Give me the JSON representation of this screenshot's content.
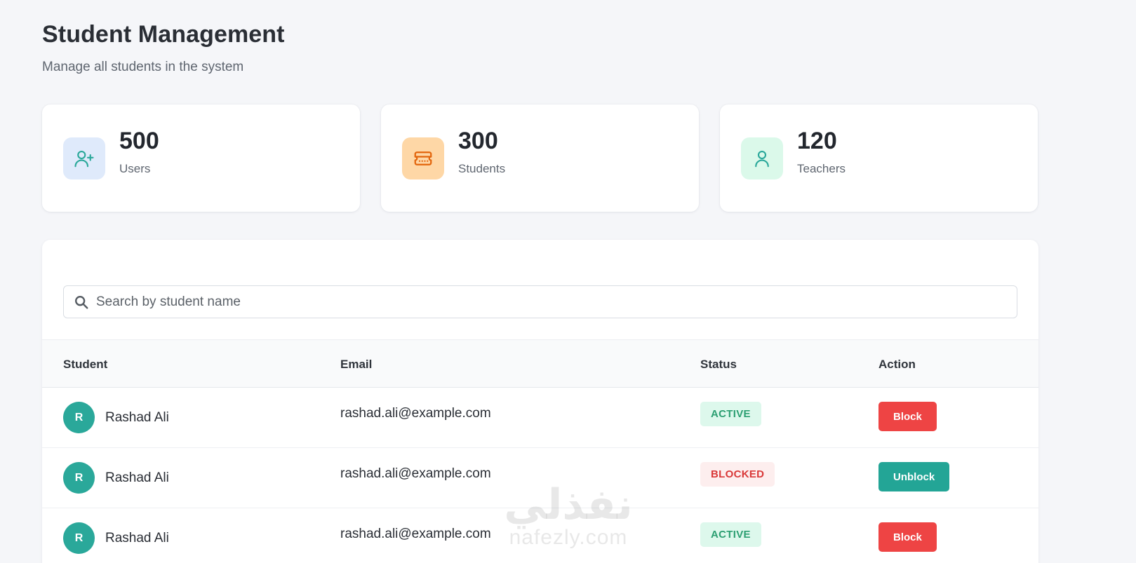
{
  "header": {
    "title": "Student Management",
    "subtitle": "Manage all students in the system"
  },
  "stats": [
    {
      "value": "500",
      "label": "Users",
      "icon": "user-plus-icon",
      "bg": "#dfeafb",
      "color": "#2aa89a"
    },
    {
      "value": "300",
      "label": "Students",
      "icon": "ticket-icon",
      "bg": "#fed7a6",
      "color": "#e2650c"
    },
    {
      "value": "120",
      "label": "Teachers",
      "icon": "user-icon",
      "bg": "#dbf9ea",
      "color": "#2aa89a"
    }
  ],
  "search": {
    "placeholder": "Search by student name",
    "value": ""
  },
  "table": {
    "columns": [
      "Student",
      "Email",
      "Status",
      "Action"
    ],
    "rows": [
      {
        "initial": "R",
        "name": "Rashad Ali",
        "email": "rashad.ali@example.com",
        "status": "ACTIVE",
        "action": "Block"
      },
      {
        "initial": "R",
        "name": "Rashad Ali",
        "email": "rashad.ali@example.com",
        "status": "BLOCKED",
        "action": "Unblock"
      },
      {
        "initial": "R",
        "name": "Rashad Ali",
        "email": "rashad.ali@example.com",
        "status": "ACTIVE",
        "action": "Block"
      }
    ]
  },
  "watermark": {
    "arabic": "نفذلي",
    "latin": "nafezly.com"
  },
  "colors": {
    "accent": "#2aa89a",
    "danger": "#ee4444",
    "active_bg": "#ddf8ec",
    "blocked_bg": "#fdeeee"
  }
}
